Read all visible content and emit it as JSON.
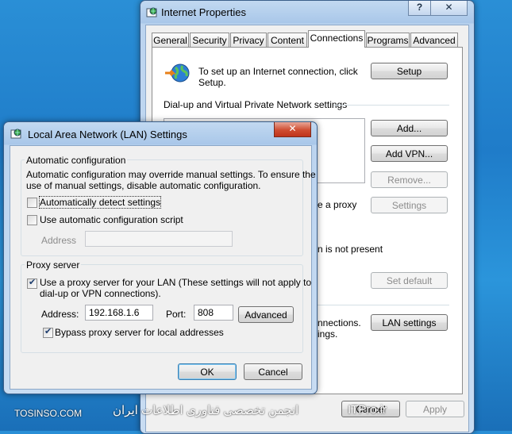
{
  "internet_properties": {
    "title": "Internet Properties",
    "help_btn": "?",
    "close_btn": "✕",
    "tabs": [
      "General",
      "Security",
      "Privacy",
      "Content",
      "Connections",
      "Programs",
      "Advanced"
    ],
    "setup_text_1": "To set up an Internet connection, click",
    "setup_text_2": "Setup.",
    "setup_btn": "Setup",
    "dialup_label": "Dial-up and Virtual Private Network settings",
    "add_btn": "Add...",
    "add_vpn_btn": "Add VPN...",
    "remove_btn": "Remove...",
    "proxy_fragment": "e a proxy",
    "settings_btn": "Settings",
    "not_present_fragment": "n is not present",
    "set_default_btn": "Set default",
    "connections_fragment_1": "nnections.",
    "connections_fragment_2": "ings.",
    "lan_settings_btn": "LAN settings",
    "cancel_btn": "Cancel",
    "apply_btn": "Apply"
  },
  "lan_dialog": {
    "title": "Local Area Network (LAN) Settings",
    "close_btn": "✕",
    "auto_config_legend": "Automatic configuration",
    "auto_config_desc_1": "Automatic configuration may override manual settings.  To ensure the",
    "auto_config_desc_2": "use of manual settings, disable automatic configuration.",
    "auto_detect_label": "Automatically detect settings",
    "auto_script_label": "Use automatic configuration script",
    "address_label": "Address",
    "address_value": "",
    "proxy_legend": "Proxy server",
    "use_proxy_label_1": "Use a proxy server for your LAN (These settings will not apply to",
    "use_proxy_label_2": "dial-up or VPN connections).",
    "proxy_address_label": "Address:",
    "proxy_address_value": "192.168.1.6",
    "port_label": "Port:",
    "port_value": "808",
    "advanced_btn": "Advanced",
    "bypass_label": "Bypass proxy server for local addresses",
    "ok_btn": "OK",
    "cancel_btn": "Cancel",
    "auto_detect_checked": false,
    "auto_script_checked": false,
    "use_proxy_checked": true,
    "bypass_checked": true
  },
  "watermark": {
    "left": "TOSINSO.COM",
    "right": "انجمن تخصصی فناوری اطلاعات ایران",
    "right2": "ITPro.ir"
  }
}
